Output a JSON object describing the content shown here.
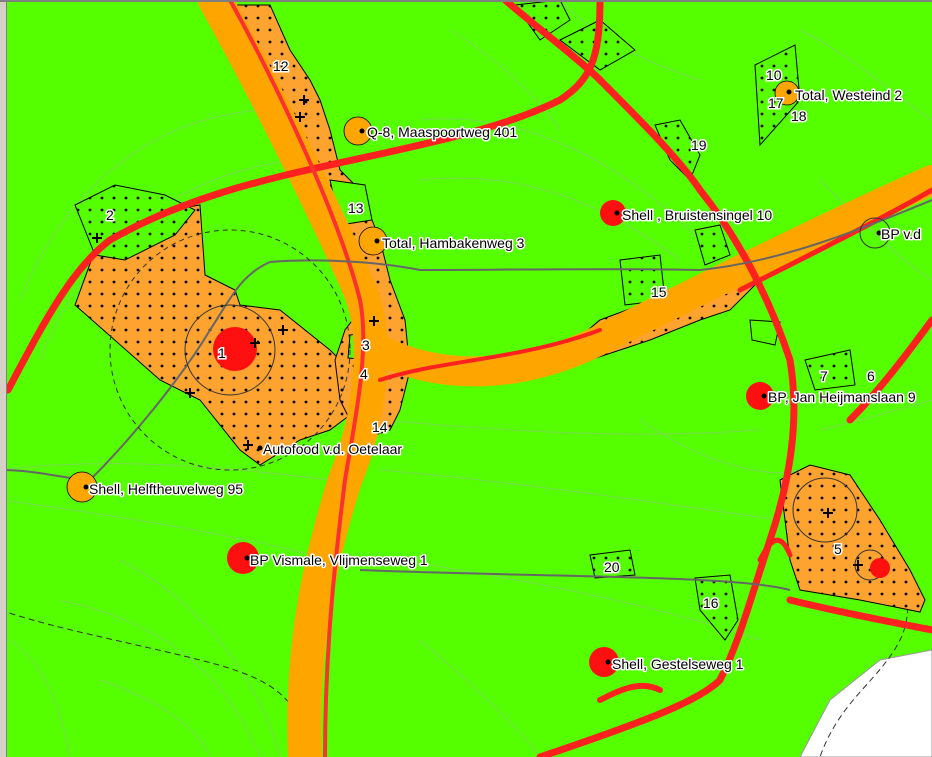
{
  "map": {
    "colors": {
      "background": "#55ff00",
      "contour": "#78d84a",
      "highway": "#ffa500",
      "road": "#ff2020",
      "rail": "#666666",
      "zone_fill": "#ffa330",
      "zone_border": "#000000",
      "station_red": "#ff1010",
      "station_orange": "#ffa500",
      "built_area": "#ffffff"
    },
    "stations": [
      {
        "label": "Q-8, Maaspoortweg 401",
        "kind": "orange"
      },
      {
        "label": "Total,  Westeind 2",
        "kind": "orange"
      },
      {
        "label": "Shell , Bruistensingel 10",
        "kind": "red"
      },
      {
        "label": "Total, Hambakenweg 3",
        "kind": "orange"
      },
      {
        "label": "BP  v.d",
        "kind": "none"
      },
      {
        "label": "BP, Jan Heijmanslaan 9",
        "kind": "red"
      },
      {
        "label": "Autofood v.d. Oetelaar",
        "kind": "none"
      },
      {
        "label": "Shell, Helftheuvelweg 95",
        "kind": "orange"
      },
      {
        "label": "BP Vismale,  Vlijmenseweg 1",
        "kind": "red"
      },
      {
        "label": "Shell, Gestelseweg 1",
        "kind": "red"
      }
    ],
    "zones": [
      {
        "id": "1",
        "label": "1"
      },
      {
        "id": "2",
        "label": "2"
      },
      {
        "id": "3",
        "label": "3"
      },
      {
        "id": "4",
        "label": "4"
      },
      {
        "id": "5",
        "label": "5"
      },
      {
        "id": "6",
        "label": "6"
      },
      {
        "id": "7",
        "label": "7"
      },
      {
        "id": "10",
        "label": "10"
      },
      {
        "id": "12",
        "label": "12"
      },
      {
        "id": "13",
        "label": "13"
      },
      {
        "id": "14",
        "label": "14"
      },
      {
        "id": "15",
        "label": "15"
      },
      {
        "id": "16",
        "label": "16"
      },
      {
        "id": "17",
        "label": "17"
      },
      {
        "id": "18",
        "label": "18"
      },
      {
        "id": "19",
        "label": "19"
      },
      {
        "id": "20",
        "label": "20"
      }
    ]
  }
}
